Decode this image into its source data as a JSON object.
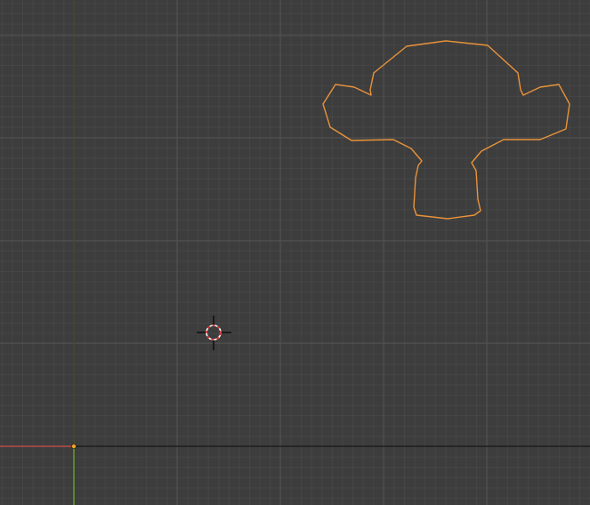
{
  "viewport": {
    "view": "2D orthographic",
    "background_color": "#3d3d3d",
    "minor_grid_color": "#454545",
    "major_grid_color": "#525252",
    "x_axis_color": "#cf4a4a",
    "y_axis_color": "#6a9a2c",
    "horizon_line_color": "#151515"
  },
  "objects": [
    {
      "name_icon": "monkey-outline-icon",
      "state": "selected",
      "outline_color": "#e8933a",
      "origin_color": "#f5a623"
    }
  ],
  "cursor_3d": {
    "icon": "crosshair-cursor-icon",
    "ring_colors": [
      "#e03030",
      "#ffffff"
    ]
  }
}
